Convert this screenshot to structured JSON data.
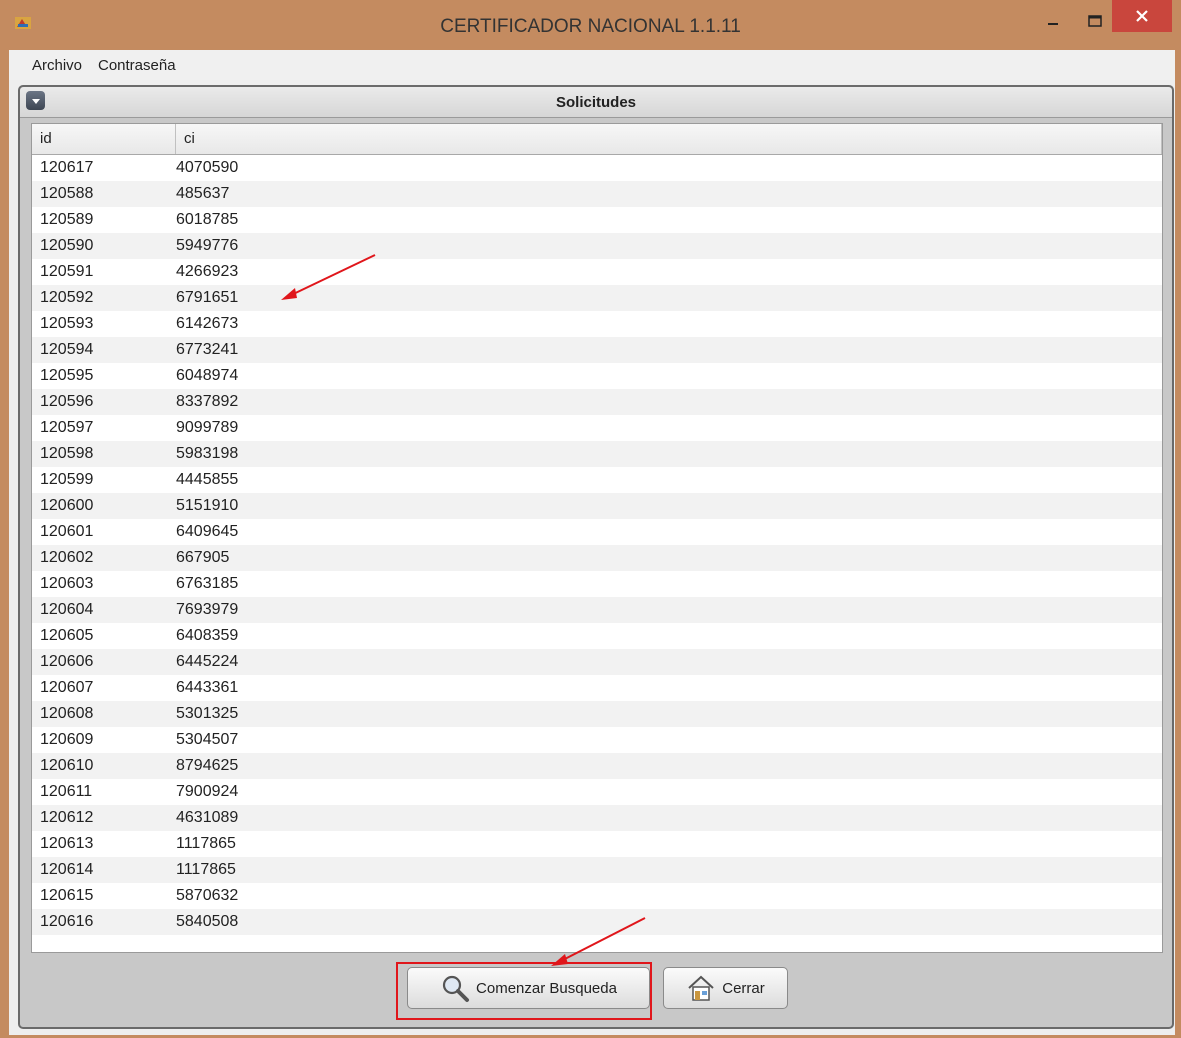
{
  "window": {
    "title": "CERTIFICADOR NACIONAL 1.1.11"
  },
  "menu": {
    "items": [
      "Archivo",
      "Contraseña"
    ]
  },
  "panel": {
    "title": "Solicitudes"
  },
  "table": {
    "columns": [
      "id",
      "ci"
    ],
    "rows": [
      [
        "120617",
        "4070590"
      ],
      [
        "120588",
        "485637"
      ],
      [
        "120589",
        "6018785"
      ],
      [
        "120590",
        "5949776"
      ],
      [
        "120591",
        "4266923"
      ],
      [
        "120592",
        "6791651"
      ],
      [
        "120593",
        "6142673"
      ],
      [
        "120594",
        "6773241"
      ],
      [
        "120595",
        "6048974"
      ],
      [
        "120596",
        "8337892"
      ],
      [
        "120597",
        "9099789"
      ],
      [
        "120598",
        "5983198"
      ],
      [
        "120599",
        "4445855"
      ],
      [
        "120600",
        "5151910"
      ],
      [
        "120601",
        "6409645"
      ],
      [
        "120602",
        "667905"
      ],
      [
        "120603",
        "6763185"
      ],
      [
        "120604",
        "7693979"
      ],
      [
        "120605",
        "6408359"
      ],
      [
        "120606",
        "6445224"
      ],
      [
        "120607",
        "6443361"
      ],
      [
        "120608",
        "5301325"
      ],
      [
        "120609",
        "5304507"
      ],
      [
        "120610",
        "8794625"
      ],
      [
        "120611",
        "7900924"
      ],
      [
        "120612",
        "4631089"
      ],
      [
        "120613",
        "1117865"
      ],
      [
        "120614",
        "1117865"
      ],
      [
        "120615",
        "5870632"
      ],
      [
        "120616",
        "5840508"
      ]
    ]
  },
  "buttons": {
    "search": "Comenzar Busqueda",
    "close": "Cerrar"
  },
  "colors": {
    "annotation": "#e0161b",
    "window_border": "#c48b60"
  },
  "icons": [
    "app-icon",
    "minimize-icon",
    "maximize-icon",
    "close-icon",
    "collapse-icon",
    "magnifier-icon",
    "home-icon"
  ]
}
